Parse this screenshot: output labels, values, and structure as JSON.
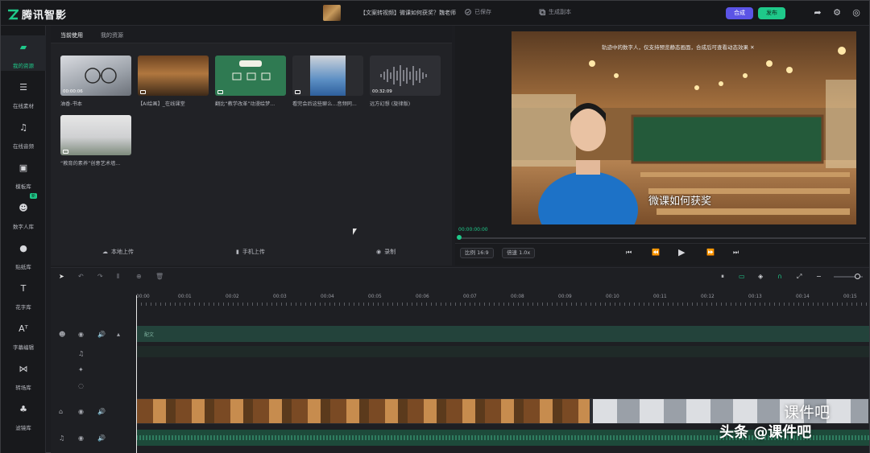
{
  "app": {
    "name": "腾讯智影"
  },
  "topbar": {
    "project_title": "【文案转视频】微课如何获奖？魏老师",
    "saved": "已保存",
    "gen_script": "生成副本",
    "compose": "合成",
    "publish": "发布"
  },
  "nav": [
    {
      "label": "我的资源",
      "icon": "folder-icon"
    },
    {
      "label": "在线素材",
      "icon": "stack-icon"
    },
    {
      "label": "在线音频",
      "icon": "music-icon"
    },
    {
      "label": "模板库",
      "icon": "film-icon"
    },
    {
      "label": "数字人库",
      "icon": "avatar-icon",
      "badge": "新"
    },
    {
      "label": "贴纸库",
      "icon": "sticker-icon"
    },
    {
      "label": "花字库",
      "icon": "text-icon"
    },
    {
      "label": "字幕编辑",
      "icon": "caption-icon"
    },
    {
      "label": "转场库",
      "icon": "transition-icon"
    },
    {
      "label": "滤镜库",
      "icon": "filter-icon"
    }
  ],
  "media": {
    "tabs": [
      "当前使用",
      "我的资源"
    ],
    "clips": [
      {
        "duration": "00:00:06",
        "name": "油香-书本"
      },
      {
        "duration": "",
        "name": "【AI绘画】_在线课堂"
      },
      {
        "duration": "",
        "name": "翻比“教学改革”动漫绘梦..."
      },
      {
        "duration": "",
        "name": "看完会后这些聊么...音频同..."
      },
      {
        "duration": "00:32:09",
        "name": "远方幻想 (旋律版)"
      },
      {
        "duration": "",
        "name": "“教育的素养”创意艺术墙..."
      }
    ],
    "uploads": [
      "本地上传",
      "手机上传",
      "录制"
    ]
  },
  "preview": {
    "tip": "轨迹中的数字人，仅支持预览静态画面，合成后可查看动态效果 ✕",
    "subtitle": "微课如何获奖",
    "time": "00:00:00:00",
    "ratio": "比例 16:9",
    "speed": "倍速 1.0x"
  },
  "timeline": {
    "ticks": [
      "00:00",
      "00:01",
      "00:02",
      "00:03",
      "00:04",
      "00:05",
      "00:06",
      "00:07",
      "00:08",
      "00:09",
      "00:10",
      "00:11",
      "00:12",
      "00:13",
      "00:14",
      "00:15"
    ],
    "subtitle_track_label": "配文"
  },
  "watermark": {
    "line1": "课件吧",
    "line2": "头条 @课件吧"
  },
  "colors": {
    "accent": "#1fc98a",
    "compose": "#5b54e6",
    "bg": "#1c1d21"
  }
}
